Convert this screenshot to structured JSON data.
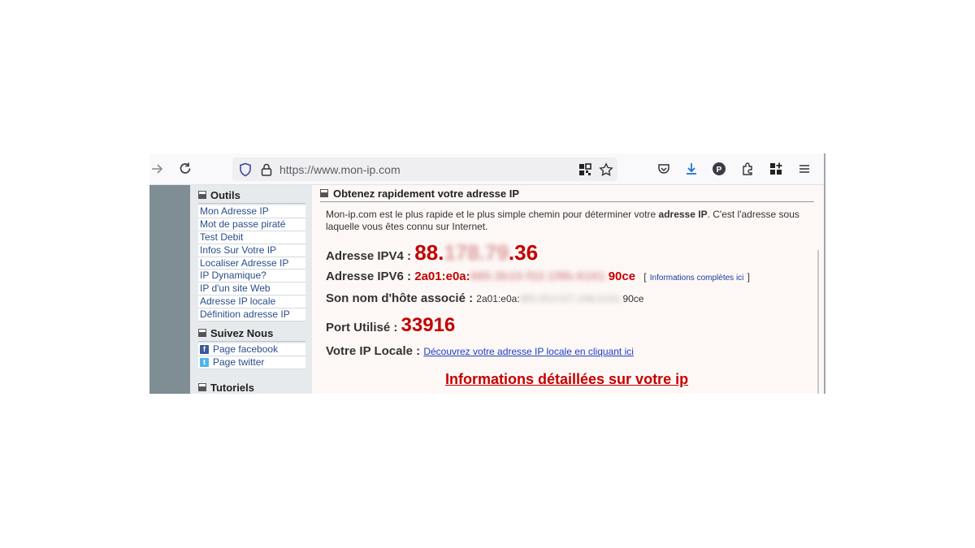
{
  "browser": {
    "url": "https://www.mon-ip.com",
    "icons": [
      "forward-icon",
      "reload-icon",
      "shield-icon",
      "lock-icon",
      "qr-icon",
      "star-icon",
      "pocket-icon",
      "download-icon",
      "profile-icon",
      "extensions-icon",
      "apps-icon",
      "menu-icon"
    ],
    "profile_letter": "P"
  },
  "sidebar": {
    "outils": {
      "title": "Outils",
      "links": [
        "Mon Adresse IP",
        "Mot de passe piraté",
        "Test Debit",
        "Infos Sur Votre IP",
        "Localiser Adresse IP",
        "IP Dynamique?",
        "IP d'un site Web",
        "Adresse IP locale",
        "Définition adresse IP"
      ]
    },
    "suivez": {
      "title": "Suivez Nous",
      "links": [
        "Page facebook",
        "Page twitter"
      ]
    },
    "tutoriels": {
      "title": "Tutoriels"
    }
  },
  "content": {
    "heading": "Obtenez rapidement votre adresse IP",
    "intro_a": "Mon-ip.com est le plus rapide et le plus simple chemin pour déterminer votre ",
    "intro_b": "adresse IP",
    "intro_c": ". C'est l'adresse sous laquelle vous êtes connu sur Internet.",
    "ipv4_label": "Adresse IPV4 :",
    "ipv4_start": "88.",
    "ipv4_hidden": "178.79",
    "ipv4_end": ".36",
    "ipv6_label": "Adresse IPV6 :",
    "ipv6_start": "2a01:e0a:",
    "ipv6_hidden": "985:3b10:f22:1f8b:6191:",
    "ipv6_end": "90ce",
    "info_link": "Informations complètes ici",
    "bracket_open": "[",
    "bracket_close": "]",
    "host_label": "Son nom d'hôte associé :",
    "host_start": "2a01:e0a:",
    "host_hidden": "985:3f10:f27:1f8b:6191:",
    "host_end": "90ce",
    "port_label": "Port Utilisé :",
    "port_value": "33916",
    "local_label": "Votre IP Locale :",
    "local_link": "Découvrez votre adresse IP locale en cliquant ici",
    "details_link": "Informations détaillées sur votre ip"
  },
  "colors": {
    "accent_red": "#c40000",
    "link_blue": "#1c3fc6",
    "sidebar_bg": "#e7eaec",
    "left_bar": "#7f8d94"
  }
}
